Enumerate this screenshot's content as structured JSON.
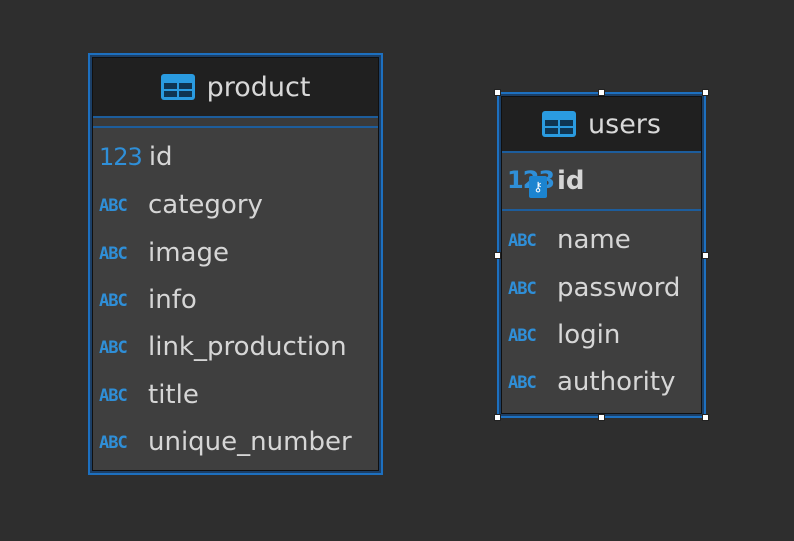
{
  "entities": {
    "product": {
      "name": "product",
      "columns": [
        {
          "type_label": "123",
          "name": "id"
        },
        {
          "type_label": "ABC",
          "name": "category"
        },
        {
          "type_label": "ABC",
          "name": "image"
        },
        {
          "type_label": "ABC",
          "name": "info"
        },
        {
          "type_label": "ABC",
          "name": "link_production"
        },
        {
          "type_label": "ABC",
          "name": "title"
        },
        {
          "type_label": "ABC",
          "name": "unique_number"
        }
      ]
    },
    "users": {
      "name": "users",
      "key_column": {
        "type_label": "123",
        "name": "id"
      },
      "columns": [
        {
          "type_label": "ABC",
          "name": "name"
        },
        {
          "type_label": "ABC",
          "name": "password"
        },
        {
          "type_label": "ABC",
          "name": "login"
        },
        {
          "type_label": "ABC",
          "name": "authority"
        }
      ]
    }
  },
  "icons": {
    "table": "table-icon",
    "numeric": "numeric-type-icon",
    "string": "string-type-icon",
    "primary_key": "key-icon"
  },
  "colors": {
    "canvas": "#2e2e2e",
    "selection_border": "#1d70c0",
    "type_icon": "#2f8fd8"
  }
}
